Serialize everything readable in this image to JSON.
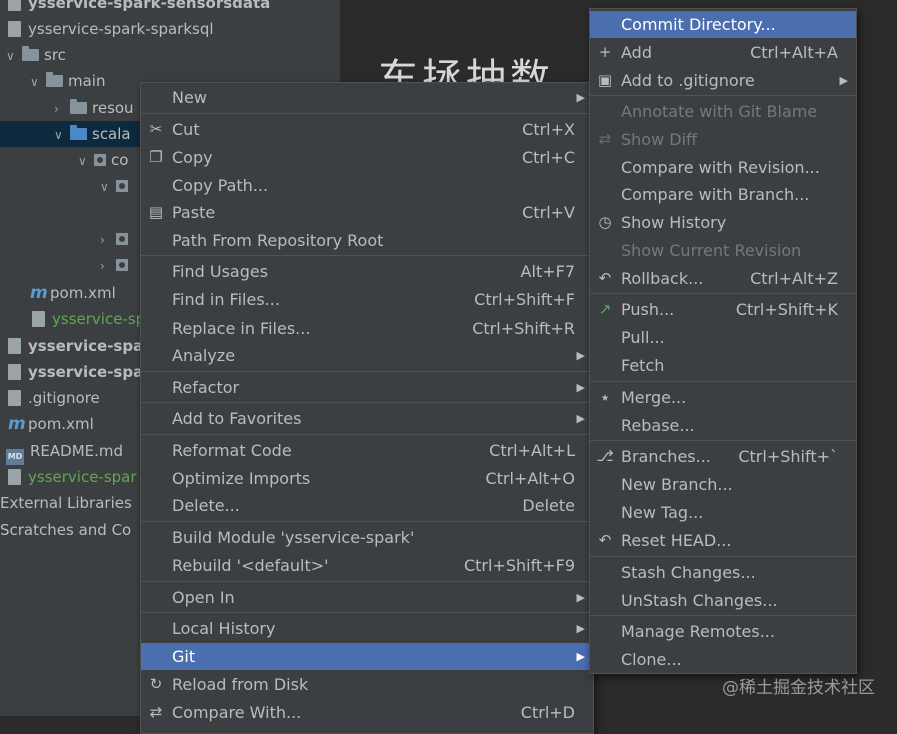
{
  "project_tree": [
    {
      "label": "ysservice-spark-sensorsdata",
      "bold": true
    },
    {
      "label": "ysservice-spark-sparksql"
    },
    {
      "label": "src"
    },
    {
      "label": "main"
    },
    {
      "label": "resou"
    },
    {
      "label": "scala"
    },
    {
      "label": "co"
    },
    {
      "label": "pom.xml"
    },
    {
      "label": "ysservice-sp"
    },
    {
      "label": "ysservice-spar",
      "bold": true
    },
    {
      "label": "ysservice-spar",
      "bold": true
    },
    {
      "label": ".gitignore"
    },
    {
      "label": "pom.xml"
    },
    {
      "label": "README.md"
    },
    {
      "label": "ysservice-spar"
    },
    {
      "label": "External Libraries"
    },
    {
      "label": "Scratches and Co"
    }
  ],
  "editor_title": "东拯抽数",
  "context_menu": {
    "items": [
      {
        "label": "New",
        "shortcut": "",
        "submenu": true
      },
      {
        "label": "Cut",
        "shortcut": "Ctrl+X",
        "icon": "cut-icon"
      },
      {
        "label": "Copy",
        "shortcut": "Ctrl+C",
        "icon": "copy-icon"
      },
      {
        "label": "Copy Path...",
        "shortcut": ""
      },
      {
        "label": "Paste",
        "shortcut": "Ctrl+V",
        "icon": "paste-icon"
      },
      {
        "label": "Path From Repository Root",
        "shortcut": ""
      },
      {
        "label": "Find Usages",
        "shortcut": "Alt+F7"
      },
      {
        "label": "Find in Files...",
        "shortcut": "Ctrl+Shift+F"
      },
      {
        "label": "Replace in Files...",
        "shortcut": "Ctrl+Shift+R"
      },
      {
        "label": "Analyze",
        "shortcut": "",
        "submenu": true
      },
      {
        "label": "Refactor",
        "shortcut": "",
        "submenu": true
      },
      {
        "label": "Add to Favorites",
        "shortcut": "",
        "submenu": true
      },
      {
        "label": "Reformat Code",
        "shortcut": "Ctrl+Alt+L"
      },
      {
        "label": "Optimize Imports",
        "shortcut": "Ctrl+Alt+O"
      },
      {
        "label": "Delete...",
        "shortcut": "Delete"
      },
      {
        "label": "Build Module 'ysservice-spark'",
        "shortcut": ""
      },
      {
        "label": "Rebuild '<default>'",
        "shortcut": "Ctrl+Shift+F9"
      },
      {
        "label": "Open In",
        "shortcut": "",
        "submenu": true
      },
      {
        "label": "Local History",
        "shortcut": "",
        "submenu": true
      },
      {
        "label": "Git",
        "shortcut": "",
        "submenu": true,
        "active": true
      },
      {
        "label": "Reload from Disk",
        "shortcut": "",
        "icon": "reload-icon"
      },
      {
        "label": "Compare With...",
        "shortcut": "Ctrl+D",
        "icon": "compare-icon"
      }
    ]
  },
  "git_submenu": {
    "items": [
      {
        "label": "Commit Directory...",
        "shortcut": "",
        "active": true
      },
      {
        "label": "Add",
        "shortcut": "Ctrl+Alt+A",
        "icon": "plus-icon"
      },
      {
        "label": "Add to .gitignore",
        "shortcut": "",
        "submenu": true,
        "icon": "gitignore-icon"
      },
      {
        "label": "Annotate with Git Blame",
        "shortcut": "",
        "disabled": true
      },
      {
        "label": "Show Diff",
        "shortcut": "",
        "disabled": true,
        "icon": "diff-icon"
      },
      {
        "label": "Compare with Revision...",
        "shortcut": ""
      },
      {
        "label": "Compare with Branch...",
        "shortcut": ""
      },
      {
        "label": "Show History",
        "shortcut": "",
        "icon": "history-icon"
      },
      {
        "label": "Show Current Revision",
        "shortcut": "",
        "disabled": true
      },
      {
        "label": "Rollback...",
        "shortcut": "Ctrl+Alt+Z",
        "icon": "rollback-icon"
      },
      {
        "label": "Push...",
        "shortcut": "Ctrl+Shift+K",
        "icon": "push-icon"
      },
      {
        "label": "Pull...",
        "shortcut": ""
      },
      {
        "label": "Fetch",
        "shortcut": ""
      },
      {
        "label": "Merge...",
        "shortcut": "",
        "icon": "merge-icon"
      },
      {
        "label": "Rebase...",
        "shortcut": ""
      },
      {
        "label": "Branches...",
        "shortcut": "Ctrl+Shift+`",
        "icon": "branch-icon"
      },
      {
        "label": "New Branch...",
        "shortcut": ""
      },
      {
        "label": "New Tag...",
        "shortcut": ""
      },
      {
        "label": "Reset HEAD...",
        "shortcut": "",
        "icon": "reset-icon"
      },
      {
        "label": "Stash Changes...",
        "shortcut": ""
      },
      {
        "label": "UnStash Changes...",
        "shortcut": ""
      },
      {
        "label": "Manage Remotes...",
        "shortcut": ""
      },
      {
        "label": "Clone...",
        "shortcut": ""
      }
    ]
  },
  "watermark": "@稀土掘金技术社区"
}
